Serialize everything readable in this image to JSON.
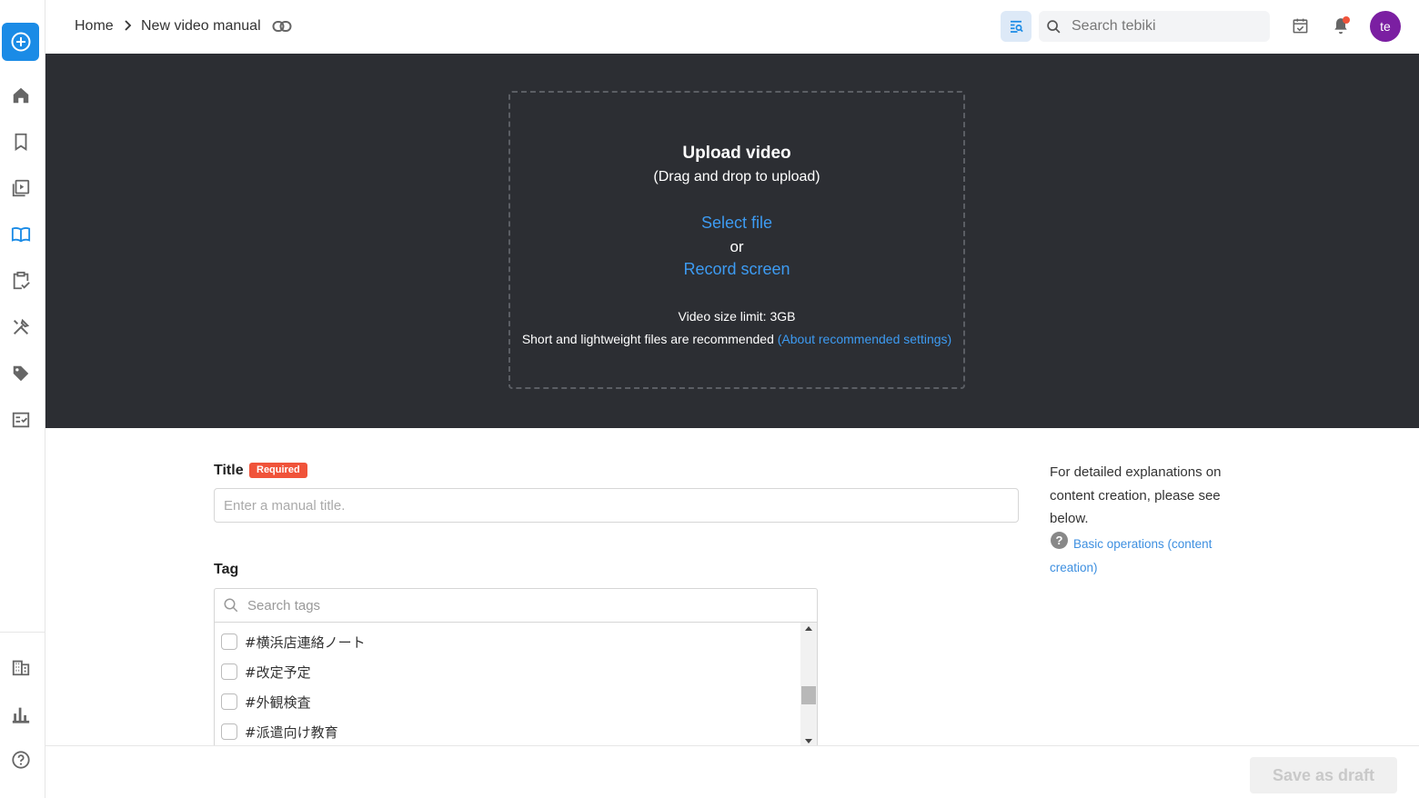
{
  "header": {
    "breadcrumb": {
      "home": "Home",
      "current": "New video manual"
    },
    "search_placeholder": "Search tebiki",
    "avatar_initials": "te"
  },
  "sidebar": {
    "items": [
      "add-icon",
      "home-icon",
      "bookmark-icon",
      "video-library-icon",
      "book-icon",
      "clipboard-check-icon",
      "tools-icon",
      "tag-icon",
      "checklist-icon",
      "building-icon",
      "bar-chart-icon",
      "help-icon"
    ]
  },
  "upload": {
    "title": "Upload video",
    "subtitle": "(Drag and drop to upload)",
    "select_file": "Select file",
    "or": "or",
    "record_screen": "Record screen",
    "size_limit": "Video size limit: 3GB",
    "recommend_text": "Short and lightweight files are recommended ",
    "recommend_link": "(About recommended settings)"
  },
  "form": {
    "title_label": "Title",
    "required_badge": "Required",
    "title_placeholder": "Enter a manual title.",
    "tag_label": "Tag",
    "tag_search_placeholder": "Search tags",
    "tags": [
      "#横浜店連絡ノート",
      "#改定予定",
      "#外観検査",
      "#派遣向け教育"
    ]
  },
  "help": {
    "text": "For detailed explanations on content creation, please see below.",
    "link": "Basic operations (content creation)"
  },
  "footer": {
    "save_draft": "Save as draft"
  },
  "colors": {
    "accent": "#1a8be6",
    "link": "#3d9bf2",
    "required": "#f0533a",
    "avatar": "#7b1fa2",
    "upload_bg": "#2c2e33"
  }
}
